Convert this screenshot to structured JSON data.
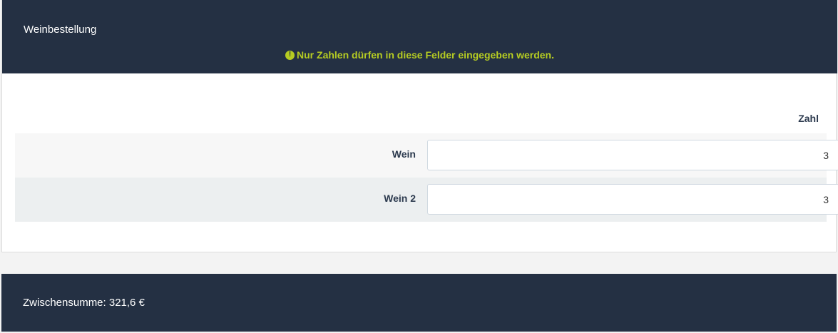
{
  "panel": {
    "title": "Weinbestellung",
    "warning": {
      "icon": "exclamation-circle-icon",
      "icon_glyph": "!",
      "text": "Nur Zahlen dürfen in diese Felder eingegeben werden.",
      "color": "#b6cc22"
    }
  },
  "table": {
    "column_header": "Zahl",
    "rows": [
      {
        "label": "Wein",
        "value": "3"
      },
      {
        "label": "Wein 2",
        "value": "3"
      }
    ]
  },
  "footer": {
    "subtotal": "Zwischensumme: 321,6 €"
  },
  "colors": {
    "header_bg": "#243043",
    "row_odd_bg": "#f7f7f7",
    "row_even_bg": "#eceff0"
  }
}
